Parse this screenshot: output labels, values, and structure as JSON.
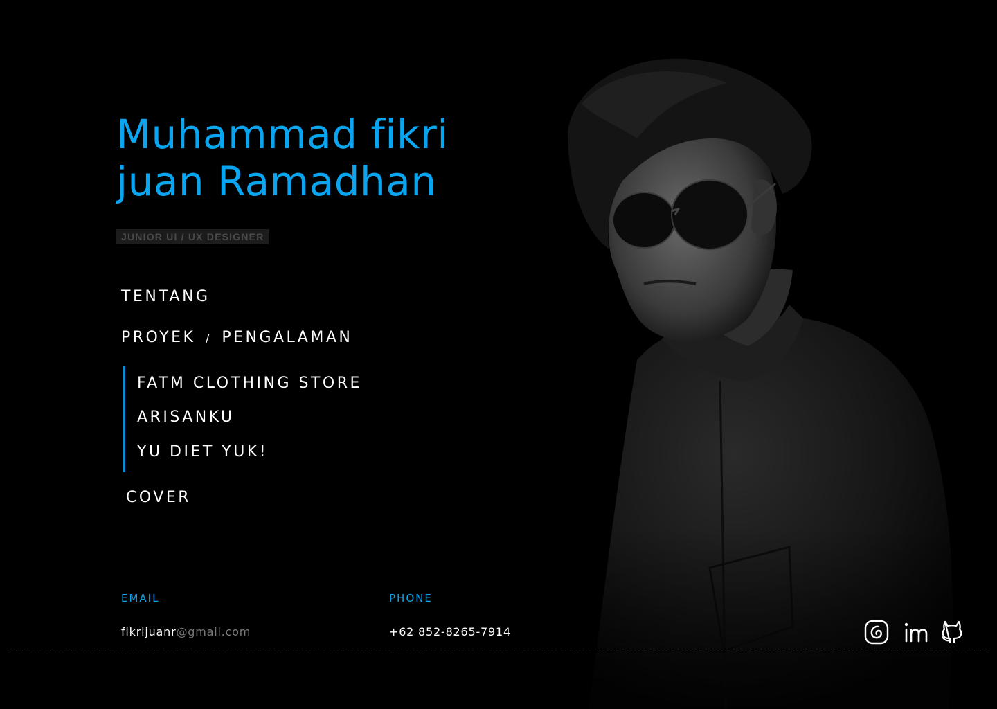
{
  "profile": {
    "name_line1": "Muhammad fikri",
    "name_line2": "juan Ramadhan",
    "role": "JUNIOR UI / UX DESIGNER"
  },
  "nav": {
    "about": "TENTANG",
    "projects_part1": "PROYEK",
    "projects_separator": "/",
    "projects_part2": "PENGALAMAN",
    "subitems": [
      "FATM CLOTHING STORE",
      "ARISANKU",
      "YU DIET YUK!"
    ],
    "cover": "COVER"
  },
  "contact": {
    "email_label": "EMAIL",
    "email_user": "fikrijuanr",
    "email_domain": "@gmail.com",
    "phone_label": "PHONE",
    "phone_value": "+62 852-8265-7914"
  },
  "social": {
    "icons": [
      "instagram-icon",
      "linkedin-icon",
      "github-icon"
    ]
  },
  "colors": {
    "accent": "#0AA5F0",
    "background": "#000000",
    "text": "#ffffff",
    "muted": "#7a7a7a"
  }
}
